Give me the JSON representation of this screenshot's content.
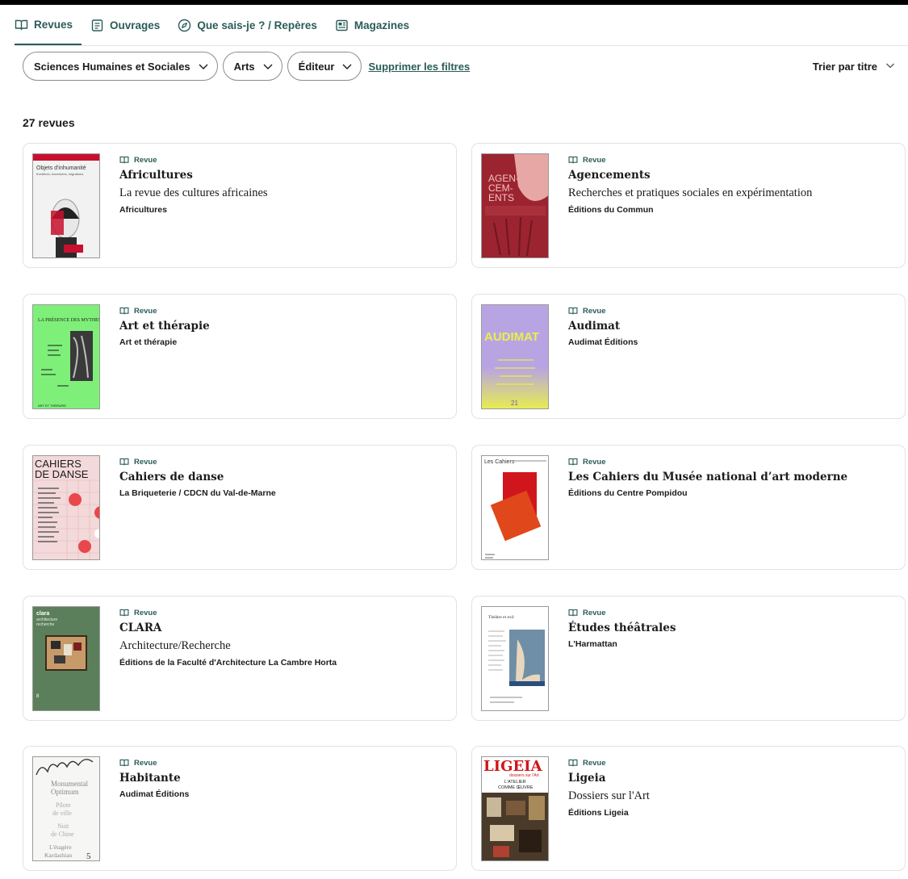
{
  "tabs": [
    {
      "label": "Revues",
      "icon": "book-open-icon",
      "active": true
    },
    {
      "label": "Ouvrages",
      "icon": "document-icon",
      "active": false
    },
    {
      "label": "Que sais-je ? / Repères",
      "icon": "compass-icon",
      "active": false
    },
    {
      "label": "Magazines",
      "icon": "newspaper-icon",
      "active": false
    }
  ],
  "filters": {
    "discipline": "Sciences Humaines et Sociales",
    "subject": "Arts",
    "publisher": "Éditeur",
    "clear_label": "Supprimer les filtres",
    "sort_label": "Trier par titre"
  },
  "results": {
    "count_label": "27 revues",
    "items": [
      {
        "type": "Revue",
        "title": "Africultures",
        "subtitle": "La revue des cultures africaines",
        "publisher": "Africultures",
        "cover": {
          "bg": "#f2f2f2",
          "accent": "#c8102e",
          "lines": [
            "Objets d'inhumanité",
            "frontières, traversées, migrations"
          ]
        }
      },
      {
        "type": "Revue",
        "title": "Agencements",
        "subtitle": "Recherches et pratiques sociales en expérimentation",
        "publisher": "Éditions du Commun",
        "cover": {
          "bg": "#9b2430",
          "accent": "#e7a7a5",
          "lines": [
            "AGEN-",
            "CEM-",
            "ENTS"
          ]
        }
      },
      {
        "type": "Revue",
        "title": "Art et thérapie",
        "subtitle": "",
        "publisher": "Art et thérapie",
        "cover": {
          "bg": "#7ef07a",
          "accent": "#1a1a1a",
          "lines": [
            "LA PRÉSENCE DES MYTHES"
          ]
        }
      },
      {
        "type": "Revue",
        "title": "Audimat",
        "subtitle": "",
        "publisher": "Audimat Éditions",
        "cover": {
          "bg": "#b9a4e3",
          "accent": "#e9ef4c",
          "lines": [
            "AUDIMAT"
          ]
        }
      },
      {
        "type": "Revue",
        "title": "Cahiers de danse",
        "subtitle": "",
        "publisher": "La Briqueterie / CDCN du Val-de-Marne",
        "cover": {
          "bg": "#f3d9d9",
          "accent": "#e8474c",
          "lines": [
            "CAHIERS",
            "DE DANSE"
          ]
        }
      },
      {
        "type": "Revue",
        "title": "Les Cahiers du Musée national d’art moderne",
        "subtitle": "",
        "publisher": "Éditions du Centre Pompidou",
        "cover": {
          "bg": "#ffffff",
          "accent": "#e0471a",
          "lines": [
            "Les Cahiers"
          ]
        }
      },
      {
        "type": "Revue",
        "title": "CLARA",
        "subtitle": "Architecture/Recherche",
        "publisher": "Éditions de la Faculté d'Architecture La Cambre Horta",
        "cover": {
          "bg": "#5b7f5a",
          "accent": "#c79a6a",
          "lines": [
            "clara",
            "architecture",
            "recherche"
          ]
        }
      },
      {
        "type": "Revue",
        "title": "Études théâtrales",
        "subtitle": "",
        "publisher": "L'Harmattan",
        "cover": {
          "bg": "#ffffff",
          "accent": "#6f8fa6",
          "lines": [
            "Théâtre et exil"
          ]
        }
      },
      {
        "type": "Revue",
        "title": "Habitante",
        "subtitle": "",
        "publisher": "Audimat Éditions",
        "cover": {
          "bg": "#f6f6f4",
          "accent": "#333333",
          "lines": [
            "HABITANTE",
            "Monumental",
            "Optimum",
            "Pilote",
            "de ville",
            "Nuit",
            "de Chine",
            "L'étagère",
            "Kardashian 5"
          ]
        }
      },
      {
        "type": "Revue",
        "title": "Ligeia",
        "subtitle": "Dossiers sur l'Art",
        "publisher": "Éditions Ligeia",
        "cover": {
          "bg": "#ffffff",
          "accent": "#d0161c",
          "lines": [
            "LIGEIA",
            "dossiers sur l'Art",
            "L'ATELIER",
            "COMME ŒUVRE"
          ]
        }
      }
    ]
  },
  "colors": {
    "accent": "#2a5c58",
    "text": "#1b1b1b",
    "border": "#e2e2e2"
  }
}
